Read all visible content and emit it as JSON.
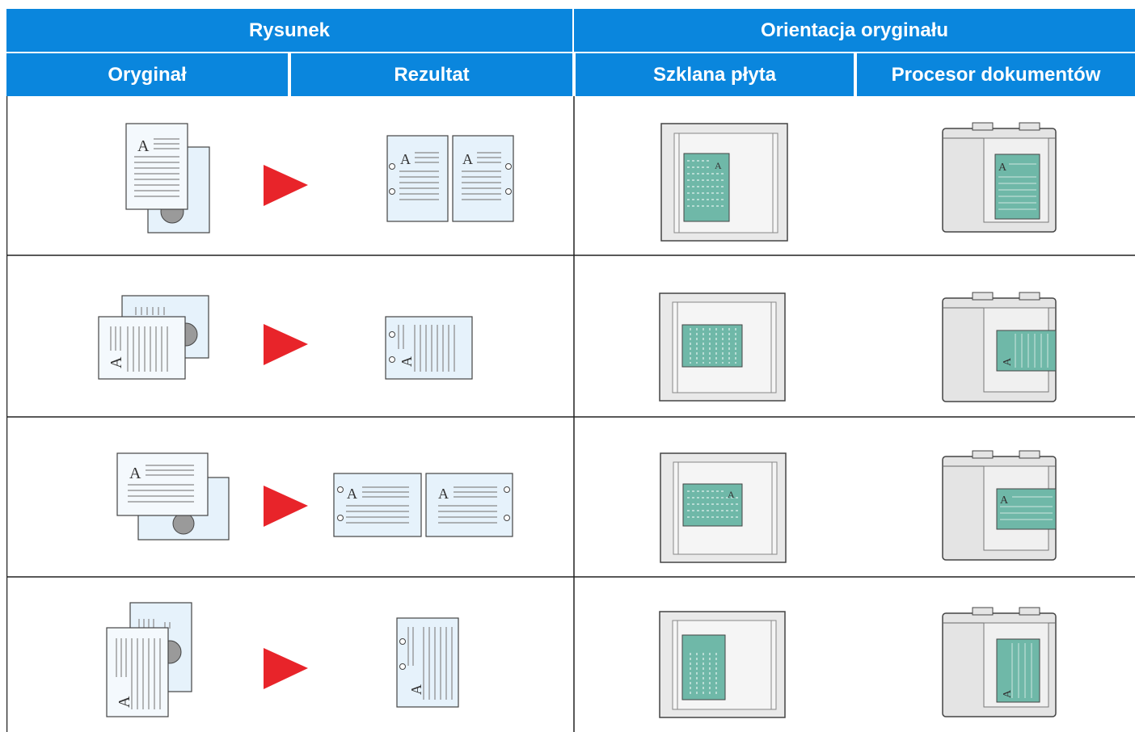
{
  "table": {
    "headers": {
      "group_figure": "Rysunek",
      "group_orientation": "Orientacja oryginału",
      "col_original": "Oryginał",
      "col_result": "Rezultat",
      "col_glass": "Szklana płyta",
      "col_feeder": "Procesor dokumentów"
    },
    "rows": [
      {
        "original": "portrait-upright",
        "result": "portrait-upright-two-pages",
        "glass": "portrait-upright",
        "feeder": "portrait-upright"
      },
      {
        "original": "landscape-rotated",
        "result": "portrait-rotated-single",
        "glass": "landscape-rotated",
        "feeder": "landscape-rotated"
      },
      {
        "original": "landscape-upright",
        "result": "landscape-upright-two-pages",
        "glass": "landscape-upright",
        "feeder": "landscape-upright"
      },
      {
        "original": "portrait-rotated",
        "result": "portrait-rotated-single",
        "glass": "portrait-rotated",
        "feeder": "portrait-rotated"
      }
    ]
  },
  "colors": {
    "header_bg": "#0a86dd",
    "header_text": "#ffffff",
    "arrow": "#e8242a",
    "document_fill": "#e6f2fb",
    "scan_sheet": "#6fb8a8",
    "grid_line": "#222222"
  },
  "icons": {
    "arrow": "right-triangle-arrow",
    "page": "document-page-icon",
    "glass": "platen-glass-icon",
    "feeder": "document-processor-icon"
  }
}
